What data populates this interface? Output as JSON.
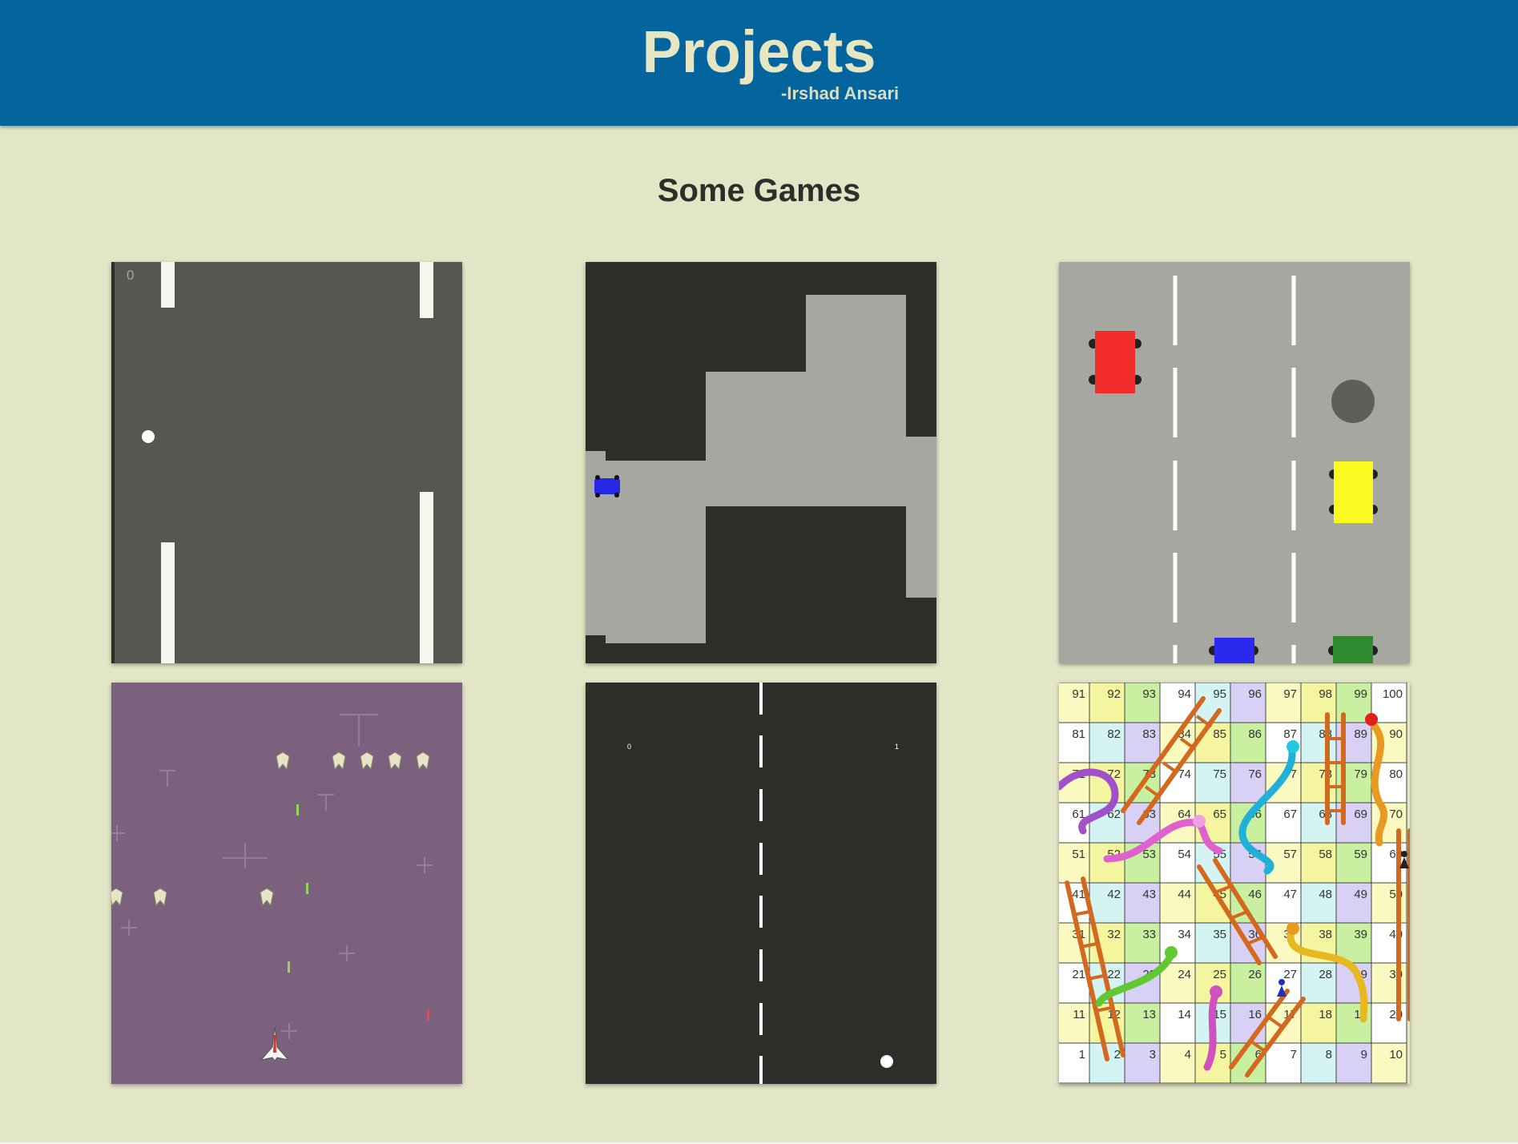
{
  "header": {
    "title": "Projects",
    "author": "-Irshad Ansari"
  },
  "section": {
    "title": "Some Games"
  },
  "games": [
    {
      "id": "pong",
      "score_left": "0"
    },
    {
      "id": "maze"
    },
    {
      "id": "car-race"
    },
    {
      "id": "space-invaders"
    },
    {
      "id": "pong-two",
      "score_left": "0",
      "score_right": "1"
    },
    {
      "id": "snakes-and-ladders",
      "board_rows": [
        [
          "91",
          "92",
          "93",
          "94",
          "95",
          "96",
          "97",
          "98",
          "99",
          "100"
        ],
        [
          "81",
          "82",
          "83",
          "84",
          "85",
          "86",
          "87",
          "88",
          "89",
          "90"
        ],
        [
          "71",
          "72",
          "73",
          "74",
          "75",
          "76",
          "77",
          "78",
          "79",
          "80"
        ],
        [
          "61",
          "62",
          "63",
          "64",
          "65",
          "66",
          "67",
          "68",
          "69",
          "70"
        ],
        [
          "51",
          "52",
          "53",
          "54",
          "55",
          "56",
          "57",
          "58",
          "59",
          "60"
        ],
        [
          "41",
          "42",
          "43",
          "44",
          "45",
          "46",
          "47",
          "48",
          "49",
          "50"
        ],
        [
          "31",
          "32",
          "33",
          "34",
          "35",
          "36",
          "37",
          "38",
          "39",
          "40"
        ],
        [
          "21",
          "22",
          "23",
          "24",
          "25",
          "26",
          "27",
          "28",
          "29",
          "30"
        ],
        [
          "11",
          "12",
          "13",
          "14",
          "15",
          "16",
          "17",
          "18",
          "19",
          "20"
        ],
        [
          "1",
          "2",
          "3",
          "4",
          "5",
          "6",
          "7",
          "8",
          "9",
          "10"
        ]
      ]
    }
  ],
  "colors": {
    "header_bg": "#04659e",
    "page_bg": "#e3e6c6",
    "title_text": "#e6e6c3"
  }
}
